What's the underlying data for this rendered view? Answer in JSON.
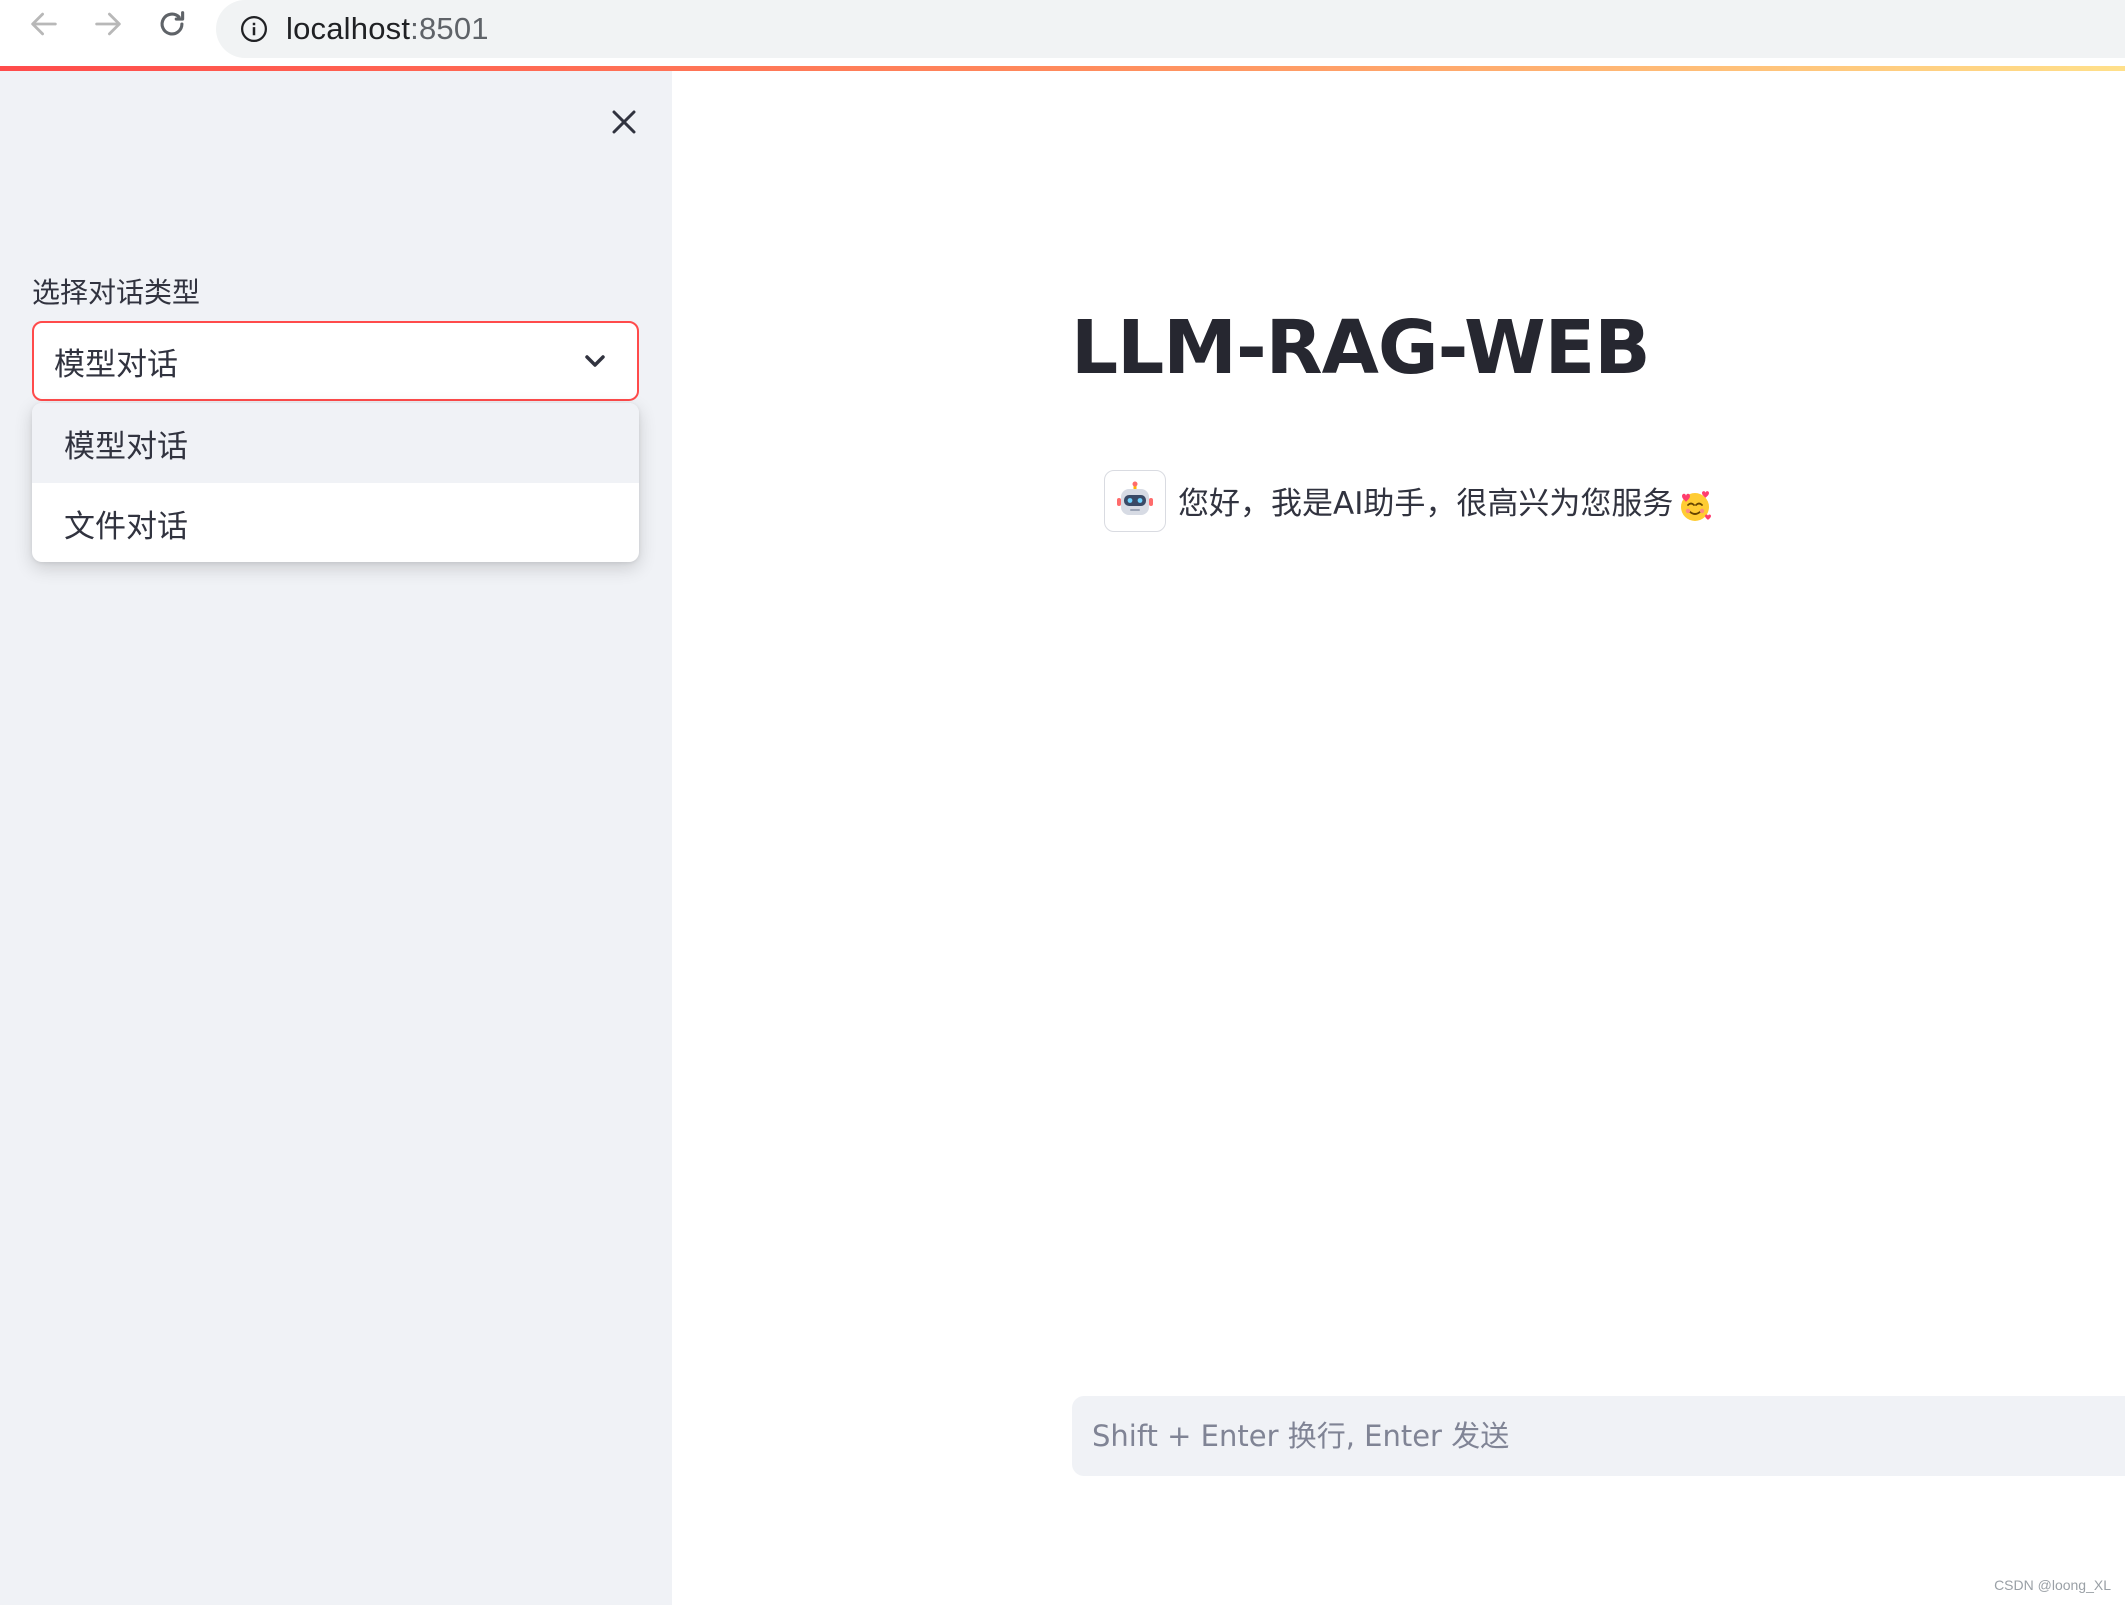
{
  "browser": {
    "url_host": "localhost",
    "url_port": ":8501",
    "icons": {
      "back": "arrow-left-icon",
      "forward": "arrow-right-icon",
      "reload": "reload-icon",
      "info": "info-icon"
    }
  },
  "sidebar": {
    "close_icon": "close-icon",
    "select": {
      "label": "选择对话类型",
      "value": "模型对话",
      "chevron_icon": "chevron-down-icon",
      "options": [
        "模型对话",
        "文件对话"
      ],
      "highlighted_index": 0
    }
  },
  "main": {
    "title": "LLM-RAG-WEB",
    "messages": [
      {
        "role": "assistant",
        "avatar_icon": "robot-icon",
        "text": "您好，我是AI助手，很高兴为您服务",
        "emoji_icon": "smiling-face-with-hearts-icon"
      }
    ],
    "chat_input": {
      "placeholder": "Shift + Enter 换行, Enter 发送",
      "value": ""
    }
  },
  "watermark": "CSDN @loong_XL",
  "colors": {
    "accent": "#ff4b4b",
    "sidebar_bg": "#f0f2f6",
    "text": "#31333f",
    "title": "#262730"
  }
}
